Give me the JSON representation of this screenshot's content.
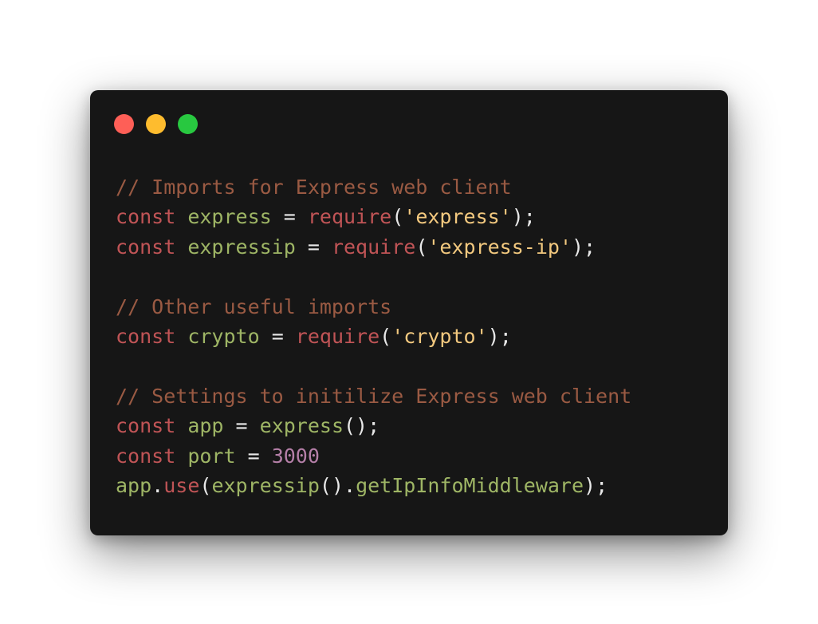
{
  "window": {
    "controls": [
      {
        "name": "close",
        "color": "#fe5f57"
      },
      {
        "name": "minimize",
        "color": "#febc2e"
      },
      {
        "name": "maximize",
        "color": "#28c840"
      }
    ]
  },
  "colors": {
    "background": "#161616",
    "comment": "#9a5a43",
    "keyword": "#c05456",
    "identifier": "#9eb565",
    "string": "#f3c97f",
    "number": "#b57fa8",
    "punctuation": "#e8e8e8"
  },
  "code": {
    "lines": [
      [
        {
          "t": "comment",
          "v": "// Imports for Express web client"
        }
      ],
      [
        {
          "t": "keyword",
          "v": "const"
        },
        {
          "t": "punct",
          "v": " "
        },
        {
          "t": "ident",
          "v": "express"
        },
        {
          "t": "punct",
          "v": " = "
        },
        {
          "t": "func",
          "v": "require"
        },
        {
          "t": "punct",
          "v": "("
        },
        {
          "t": "string",
          "v": "'express'"
        },
        {
          "t": "punct",
          "v": ");"
        }
      ],
      [
        {
          "t": "keyword",
          "v": "const"
        },
        {
          "t": "punct",
          "v": " "
        },
        {
          "t": "ident",
          "v": "expressip"
        },
        {
          "t": "punct",
          "v": " = "
        },
        {
          "t": "func",
          "v": "require"
        },
        {
          "t": "punct",
          "v": "("
        },
        {
          "t": "string",
          "v": "'express-ip'"
        },
        {
          "t": "punct",
          "v": ");"
        }
      ],
      [],
      [
        {
          "t": "comment",
          "v": "// Other useful imports"
        }
      ],
      [
        {
          "t": "keyword",
          "v": "const"
        },
        {
          "t": "punct",
          "v": " "
        },
        {
          "t": "ident",
          "v": "crypto"
        },
        {
          "t": "punct",
          "v": " = "
        },
        {
          "t": "func",
          "v": "require"
        },
        {
          "t": "punct",
          "v": "("
        },
        {
          "t": "string",
          "v": "'crypto'"
        },
        {
          "t": "punct",
          "v": ");"
        }
      ],
      [],
      [
        {
          "t": "comment",
          "v": "// Settings to initilize Express web client"
        }
      ],
      [
        {
          "t": "keyword",
          "v": "const"
        },
        {
          "t": "punct",
          "v": " "
        },
        {
          "t": "ident",
          "v": "app"
        },
        {
          "t": "punct",
          "v": " = "
        },
        {
          "t": "ident",
          "v": "express"
        },
        {
          "t": "punct",
          "v": "();"
        }
      ],
      [
        {
          "t": "keyword",
          "v": "const"
        },
        {
          "t": "punct",
          "v": " "
        },
        {
          "t": "ident",
          "v": "port"
        },
        {
          "t": "punct",
          "v": " = "
        },
        {
          "t": "number",
          "v": "3000"
        }
      ],
      [
        {
          "t": "ident",
          "v": "app"
        },
        {
          "t": "punct",
          "v": "."
        },
        {
          "t": "func",
          "v": "use"
        },
        {
          "t": "punct",
          "v": "("
        },
        {
          "t": "ident",
          "v": "expressip"
        },
        {
          "t": "punct",
          "v": "()."
        },
        {
          "t": "ident",
          "v": "getIpInfoMiddleware"
        },
        {
          "t": "punct",
          "v": ");"
        }
      ]
    ]
  }
}
